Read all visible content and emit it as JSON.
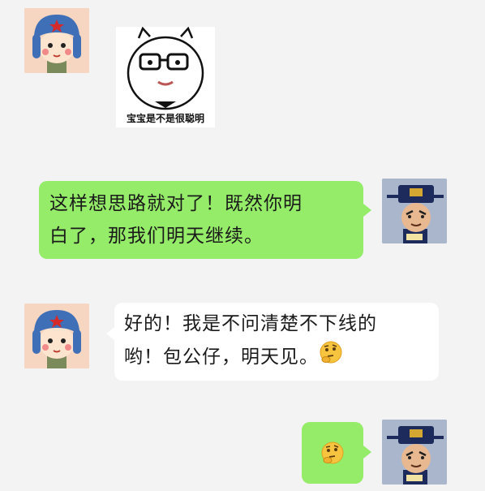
{
  "messages": [
    {
      "sender": "soldier",
      "type": "sticker",
      "caption": "宝宝是不是很聪明",
      "avatar_icon": "soldier-avatar-icon"
    },
    {
      "sender": "judge",
      "type": "text",
      "lines": [
        "这样想思路就对了！既然你明",
        "白了，那我们明天继续。"
      ],
      "avatar_icon": "judge-avatar-icon"
    },
    {
      "sender": "soldier",
      "type": "text",
      "lines": [
        "好的！我是不问清楚不下线的",
        "哟！包公仔，明天见。"
      ],
      "emoji": "thinking-face-icon",
      "avatar_icon": "soldier-avatar-icon"
    },
    {
      "sender": "judge",
      "type": "emoji",
      "emoji": "thinking-face-icon",
      "avatar_icon": "judge-avatar-icon"
    }
  ],
  "colors": {
    "background": "#f3f3f3",
    "own_bubble": "#95ec69",
    "other_bubble": "#ffffff"
  }
}
